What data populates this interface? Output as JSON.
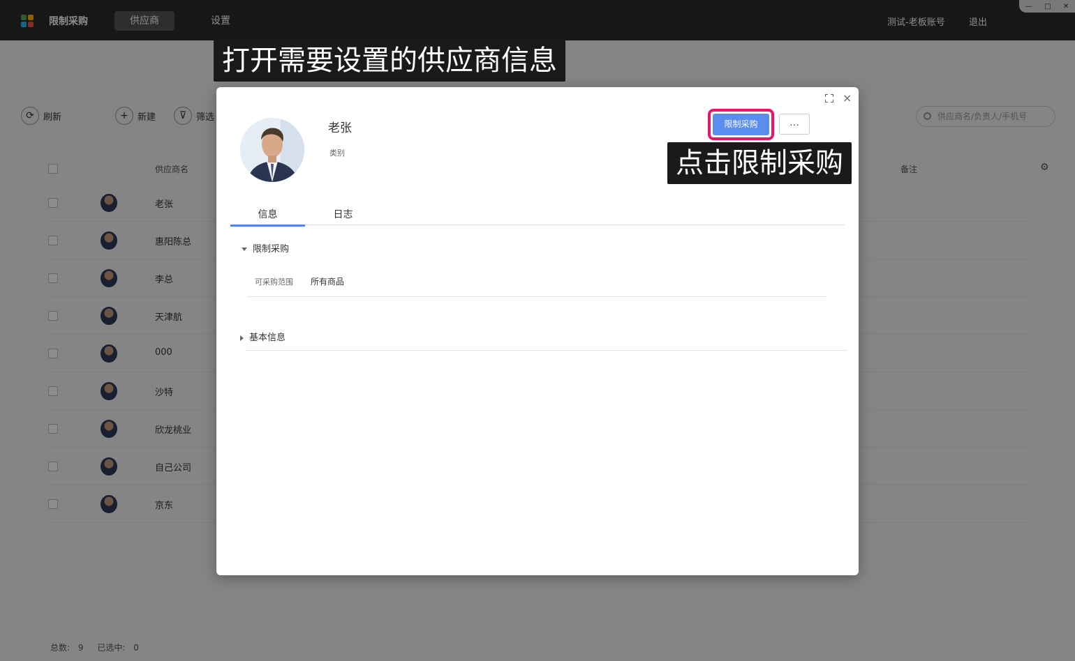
{
  "topbar": {
    "app_title": "限制采购",
    "tabs": [
      {
        "label": "供应商"
      },
      {
        "label": "设置"
      }
    ],
    "account": "测试-老板账号",
    "logout": "退出"
  },
  "toolbar": {
    "refresh": "刷新",
    "add": "新建",
    "filter": "筛选",
    "search_placeholder": "供应商名/负责人/手机号"
  },
  "table": {
    "col_name": "供应商名",
    "col_remark": "备注",
    "rows": [
      "老张",
      "惠阳陈总",
      "李总",
      "天津航",
      "000",
      "沙特",
      "欣龙桃业",
      "自己公司",
      "京东"
    ]
  },
  "footer": {
    "total_label": "总数:",
    "total": "9",
    "selected_label": "已选中:",
    "selected": "0"
  },
  "captions": {
    "top": "打开需要设置的供应商信息",
    "right": "点击限制采购"
  },
  "modal": {
    "supplier_name": "老张",
    "category_label": "类别",
    "restrict_button": "限制采购",
    "more_button": "···",
    "tabs": [
      {
        "label": "信息"
      },
      {
        "label": "日志"
      }
    ],
    "restrict_section": {
      "title": "限制采购",
      "field_label": "可采购范围",
      "field_value": "所有商品"
    },
    "basic_section": {
      "title": "基本信息"
    },
    "close_icon": "×"
  },
  "colors": {
    "highlight": "#e8166b",
    "primary": "#5b8def",
    "tab_active": "#4a86e8"
  }
}
